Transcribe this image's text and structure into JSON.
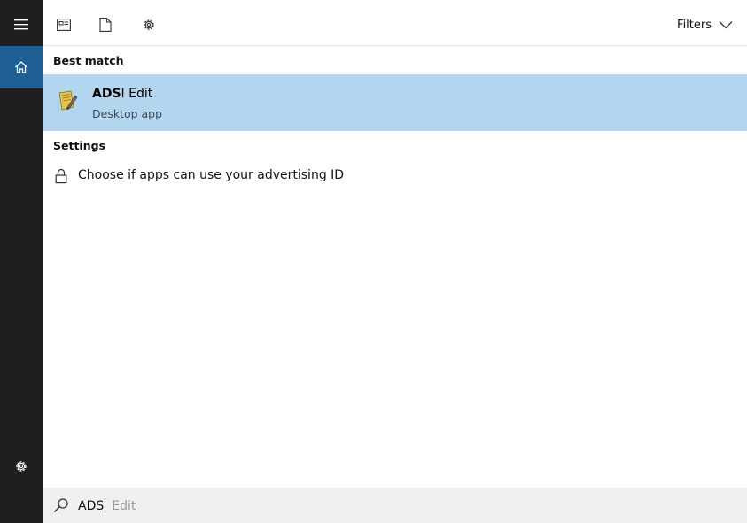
{
  "sidebar": {
    "menu_icon": "hamburger-icon",
    "home_icon": "home-icon",
    "settings_icon": "gear-icon",
    "active_color": "#1e5f96"
  },
  "topbar": {
    "icons": [
      "news-icon",
      "document-icon",
      "gear-icon"
    ],
    "filters_label": "Filters"
  },
  "results": {
    "best_match_label": "Best match",
    "best_match": {
      "name_highlight": "ADS",
      "name_rest": "I Edit",
      "type": "Desktop app",
      "icon": "adsi-edit-icon",
      "highlight_color": "#b3d6f0"
    },
    "settings_label": "Settings",
    "settings_items": [
      {
        "label": "Choose if apps can use your advertising ID",
        "icon": "lock-icon"
      }
    ]
  },
  "search": {
    "typed": "ADS",
    "suggestion": "Edit",
    "icon": "search-icon"
  }
}
